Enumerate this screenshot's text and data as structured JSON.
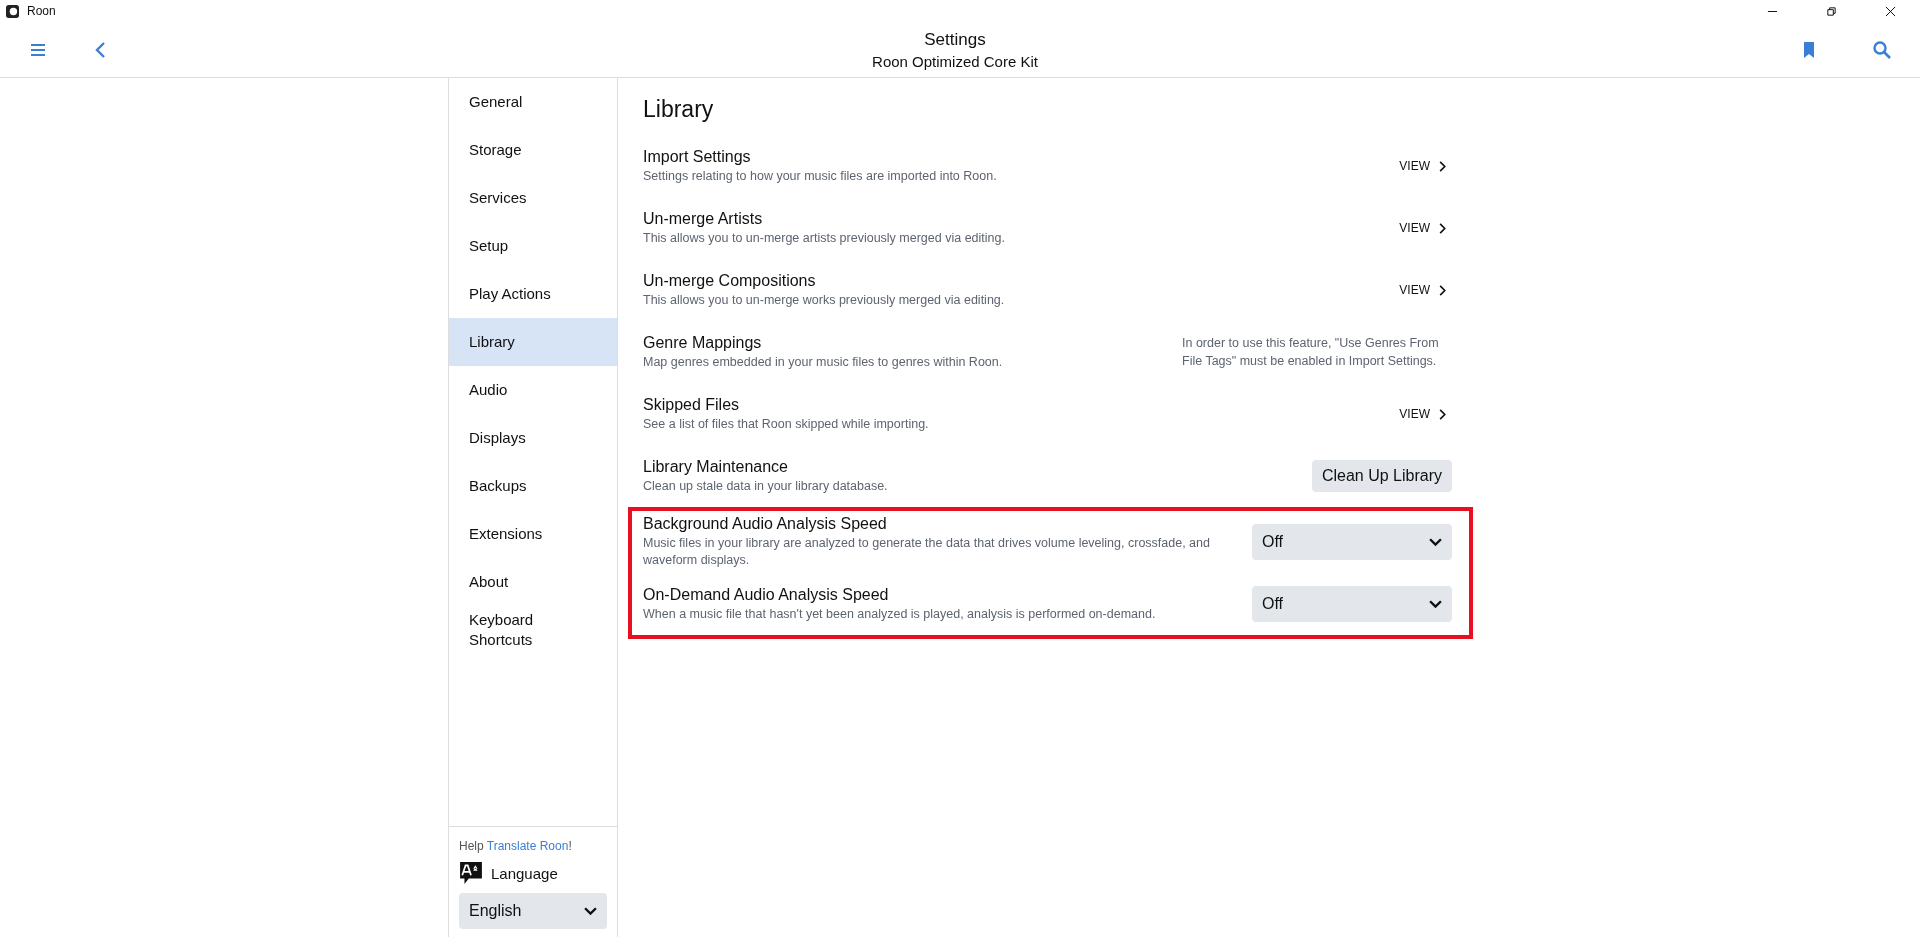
{
  "window": {
    "title": "Roon"
  },
  "header": {
    "title": "Settings",
    "subtitle": "Roon Optimized Core Kit"
  },
  "sidebar": {
    "items": [
      {
        "label": "General",
        "selected": false
      },
      {
        "label": "Storage",
        "selected": false
      },
      {
        "label": "Services",
        "selected": false
      },
      {
        "label": "Setup",
        "selected": false
      },
      {
        "label": "Play Actions",
        "selected": false
      },
      {
        "label": "Library",
        "selected": true
      },
      {
        "label": "Audio",
        "selected": false
      },
      {
        "label": "Displays",
        "selected": false
      },
      {
        "label": "Backups",
        "selected": false
      },
      {
        "label": "Extensions",
        "selected": false
      },
      {
        "label": "About",
        "selected": false
      },
      {
        "label": "Keyboard Shortcuts",
        "selected": false
      }
    ],
    "help": {
      "before": "Help",
      "link": "Translate Roon",
      "after": "!"
    },
    "language_label": "Language",
    "language_value": "English"
  },
  "content": {
    "heading": "Library",
    "rows": [
      {
        "kind": "view",
        "title": "Import Settings",
        "description": "Settings relating to how your music files are imported into Roon.",
        "action": "VIEW",
        "highlighted": false
      },
      {
        "kind": "view",
        "title": "Un-merge Artists",
        "description": "This allows you to un-merge artists previously merged via editing.",
        "action": "VIEW",
        "highlighted": false
      },
      {
        "kind": "view",
        "title": "Un-merge Compositions",
        "description": "This allows you to un-merge works previously merged via editing.",
        "action": "VIEW",
        "highlighted": false
      },
      {
        "kind": "note",
        "title": "Genre Mappings",
        "description": "Map genres embedded in your music files to genres within Roon.",
        "action": "In order to use this feature, \"Use Genres From File Tags\" must be enabled in Import Settings.",
        "highlighted": false
      },
      {
        "kind": "view",
        "title": "Skipped Files",
        "description": "See a list of files that Roon skipped while importing.",
        "action": "VIEW",
        "highlighted": false
      },
      {
        "kind": "button",
        "title": "Library Maintenance",
        "description": "Clean up stale data in your library database.",
        "action": "Clean Up Library",
        "highlighted": false
      },
      {
        "kind": "dropdown",
        "title": "Background Audio Analysis Speed",
        "description": "Music files in your library are analyzed to generate the data that drives volume leveling, crossfade, and waveform displays.",
        "action": "Off",
        "highlighted": true
      },
      {
        "kind": "dropdown",
        "title": "On-Demand Audio Analysis Speed",
        "description": "When a music file that hasn't yet been analyzed is played, analysis is performed on-demand.",
        "action": "Off",
        "highlighted": true
      }
    ]
  }
}
